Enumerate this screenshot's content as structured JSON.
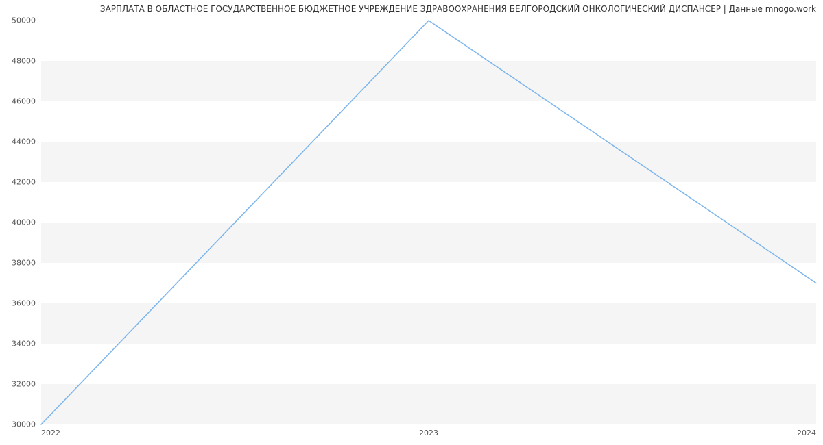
{
  "title": "ЗАРПЛАТА В ОБЛАСТНОЕ ГОСУДАРСТВЕННОЕ БЮДЖЕТНОЕ УЧРЕЖДЕНИЕ ЗДРАВООХРАНЕНИЯ БЕЛГОРОДСКИЙ ОНКОЛОГИЧЕСКИЙ ДИСПАНСЕР | Данные mnogo.work",
  "chart_data": {
    "type": "line",
    "x": [
      2022,
      2023,
      2024
    ],
    "values": [
      30000,
      50000,
      37000
    ],
    "x_ticks": [
      2022,
      2023,
      2024
    ],
    "y_ticks": [
      30000,
      32000,
      34000,
      36000,
      38000,
      40000,
      42000,
      44000,
      46000,
      48000,
      50000
    ],
    "ylim": [
      30000,
      50000
    ],
    "xlim": [
      2022,
      2024
    ],
    "title": "ЗАРПЛАТА В ОБЛАСТНОЕ ГОСУДАРСТВЕННОЕ БЮДЖЕТНОЕ УЧРЕЖДЕНИЕ ЗДРАВООХРАНЕНИЯ БЕЛГОРОДСКИЙ ОНКОЛОГИЧЕСКИЙ ДИСПАНСЕР | Данные mnogo.work",
    "xlabel": "",
    "ylabel": "",
    "line_color": "#7cb5ec"
  }
}
